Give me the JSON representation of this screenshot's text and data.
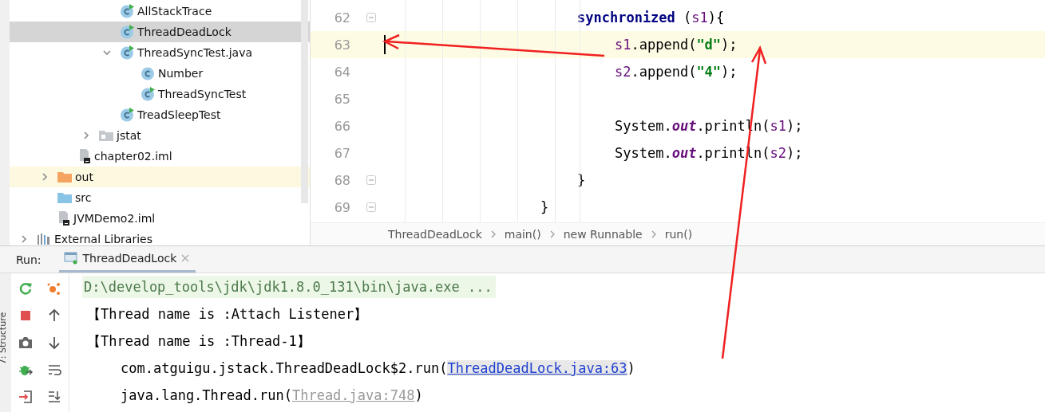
{
  "project_tree": [
    {
      "children": [
        {
          "children": [
            {
              "children": [
                {
                  "children": [
                    {
                      "label": "AllStackTrace",
                      "kind": "main_class",
                      "selected": false,
                      "highlighted": false
                    },
                    {
                      "label": "ThreadDeadLock",
                      "kind": "main_class",
                      "selected": true,
                      "highlighted": false
                    },
                    {
                      "label": "ThreadSyncTest.java",
                      "kind": "main_class",
                      "selected": false,
                      "highlighted": false,
                      "expanded": true,
                      "children": [
                        {
                          "label": "Number",
                          "kind": "class",
                          "selected": false,
                          "highlighted": false
                        },
                        {
                          "label": "ThreadSyncTest",
                          "kind": "main_class",
                          "selected": false,
                          "highlighted": false
                        }
                      ]
                    },
                    {
                      "label": "TreadSleepTest",
                      "kind": "main_class",
                      "selected": false,
                      "highlighted": false
                    }
                  ]
                },
                {
                  "label": "jstat",
                  "kind": "package",
                  "selected": false,
                  "highlighted": false,
                  "expanded": false
                }
              ]
            },
            {
              "label": "chapter02.iml",
              "kind": "module_file",
              "selected": false,
              "highlighted": false
            }
          ]
        },
        {
          "label": "out",
          "kind": "excluded_folder",
          "selected": false,
          "highlighted": true,
          "expanded": false
        },
        {
          "label": "src",
          "kind": "source_folder",
          "selected": false,
          "highlighted": false
        },
        {
          "label": "JVMDemo2.iml",
          "kind": "module_file",
          "selected": false,
          "highlighted": false
        }
      ]
    },
    {
      "label": "External Libraries",
      "kind": "library",
      "selected": false,
      "highlighted": false,
      "expanded": false
    }
  ],
  "editor": {
    "lines": [
      {
        "number": "62",
        "current": false,
        "fold": true,
        "kind": "block",
        "tokens": [
          {
            "t": "synchronized",
            "kind": "keyword"
          },
          {
            "t": " ("
          },
          {
            "t": "s1",
            "kind": "var"
          },
          {
            "t": "){"
          }
        ]
      },
      {
        "number": "63",
        "current": true,
        "fold": false,
        "kind": "inner",
        "tokens": [
          {
            "t": "s1",
            "kind": "var"
          },
          {
            "t": ".append("
          },
          {
            "t": "\"d\"",
            "kind": "string"
          },
          {
            "t": ");"
          }
        ]
      },
      {
        "number": "64",
        "current": false,
        "fold": false,
        "kind": "inner",
        "tokens": [
          {
            "t": "s2",
            "kind": "var"
          },
          {
            "t": ".append("
          },
          {
            "t": "\"4\"",
            "kind": "string"
          },
          {
            "t": ");"
          }
        ]
      },
      {
        "number": "65",
        "current": false,
        "fold": false
      },
      {
        "number": "66",
        "current": false,
        "fold": false,
        "kind": "inner",
        "tokens": [
          {
            "t": "System."
          },
          {
            "t": "out",
            "kind": "field"
          },
          {
            "t": ".println("
          },
          {
            "t": "s1",
            "kind": "var"
          },
          {
            "t": ");"
          }
        ]
      },
      {
        "number": "67",
        "current": false,
        "fold": false,
        "kind": "inner",
        "tokens": [
          {
            "t": "System."
          },
          {
            "t": "out",
            "kind": "field"
          },
          {
            "t": ".println("
          },
          {
            "t": "s2",
            "kind": "var"
          },
          {
            "t": ");"
          }
        ]
      },
      {
        "number": "68",
        "current": false,
        "fold": true,
        "kind": "block",
        "tokens": [
          {
            "t": "}"
          }
        ]
      },
      {
        "number": "69",
        "current": false,
        "fold": true,
        "kind": "outer",
        "tokens": [
          {
            "t": "}"
          }
        ]
      }
    ],
    "breadcrumb": [
      "ThreadDeadLock",
      "main()",
      "new Runnable",
      "run()"
    ]
  },
  "run_panel": {
    "label": "Run:",
    "tab": {
      "label": "ThreadDeadLock",
      "selected": true
    },
    "side_label": "7: Structure",
    "console": [
      {
        "kind": "command",
        "text": "D:\\develop_tools\\jdk\\jdk1.8.0_131\\bin\\java.exe ..."
      },
      {
        "kind": "plain",
        "text": "【Thread name is :Attach Listener】"
      },
      {
        "kind": "plain",
        "text": "【Thread name is :Thread-1】"
      },
      {
        "kind": "frame",
        "text": "com.atguigu.jstack.ThreadDeadLock$2.run(",
        "link": "ThreadDeadLock.java:63",
        "muted": false,
        "after": ")"
      },
      {
        "kind": "frame",
        "text": "java.lang.Thread.run(",
        "link": "Thread.java:748",
        "muted": true,
        "after": ")"
      }
    ]
  }
}
